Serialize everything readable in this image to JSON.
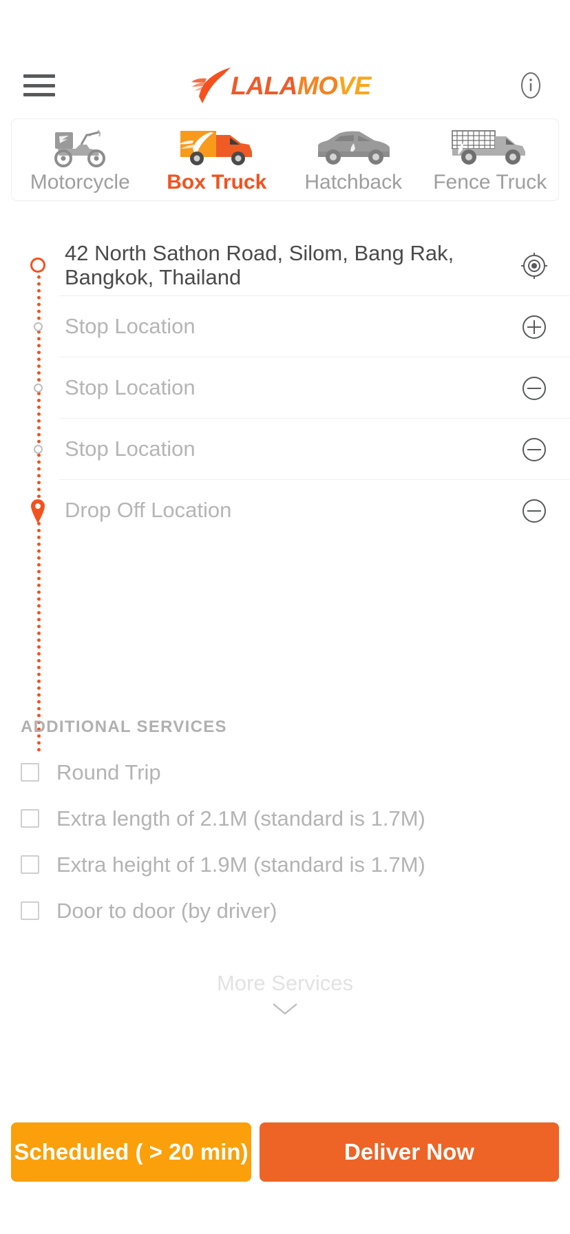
{
  "header": {
    "menu_icon": "hamburger-menu-icon",
    "logo_bird_icon": "lalamove-bird-icon",
    "logo_part1": "LALA",
    "logo_part2": "MO",
    "logo_part3": "VE",
    "info_icon": "info-circle-icon"
  },
  "vehicle_tabs": [
    {
      "label": "Motorcycle",
      "icon": "motorcycle-icon",
      "selected": false
    },
    {
      "label": "Box Truck",
      "icon": "box-truck-icon",
      "selected": true
    },
    {
      "label": "Hatchback",
      "icon": "hatchback-icon",
      "selected": false
    },
    {
      "label": "Fence Truck",
      "icon": "fence-truck-icon",
      "selected": false
    }
  ],
  "addresses": [
    {
      "value": "42 North Sathon Road, Silom, Bang Rak, Bangkok, Thailand",
      "placeholder": "",
      "marker": "origin-circle-marker",
      "action_icon": "locate-target-icon",
      "is_placeholder": false
    },
    {
      "value": "",
      "placeholder": "Stop Location",
      "marker": "stop-dot-marker",
      "action_icon": "plus-circle-icon",
      "is_placeholder": true
    },
    {
      "value": "",
      "placeholder": "Stop Location",
      "marker": "stop-dot-marker",
      "action_icon": "minus-circle-icon",
      "is_placeholder": true
    },
    {
      "value": "",
      "placeholder": "Stop Location",
      "marker": "stop-dot-marker",
      "action_icon": "minus-circle-icon",
      "is_placeholder": true
    },
    {
      "value": "",
      "placeholder": "Drop Off Location",
      "marker": "destination-pin-marker",
      "action_icon": "minus-circle-icon",
      "is_placeholder": true
    }
  ],
  "services": {
    "title": "ADDITIONAL SERVICES",
    "options": [
      {
        "label": "Round Trip",
        "checked": false
      },
      {
        "label": "Extra length of 2.1M (standard is 1.7M)",
        "checked": false
      },
      {
        "label": "Extra height of 1.9M (standard is 1.7M)",
        "checked": false
      },
      {
        "label": "Door to door (by driver)",
        "checked": false
      }
    ],
    "more_label": "More Services",
    "more_icon": "chevron-down-icon"
  },
  "actions": {
    "scheduled_label": "Scheduled ( > 20 min)",
    "deliver_label": "Deliver Now"
  },
  "colors": {
    "brand_orange": "#f4511e",
    "logo_amber": "#faa61a",
    "scheduled_button": "#fba00b",
    "deliver_button": "#ed6426",
    "placeholder_gray": "#b5b5b5"
  }
}
